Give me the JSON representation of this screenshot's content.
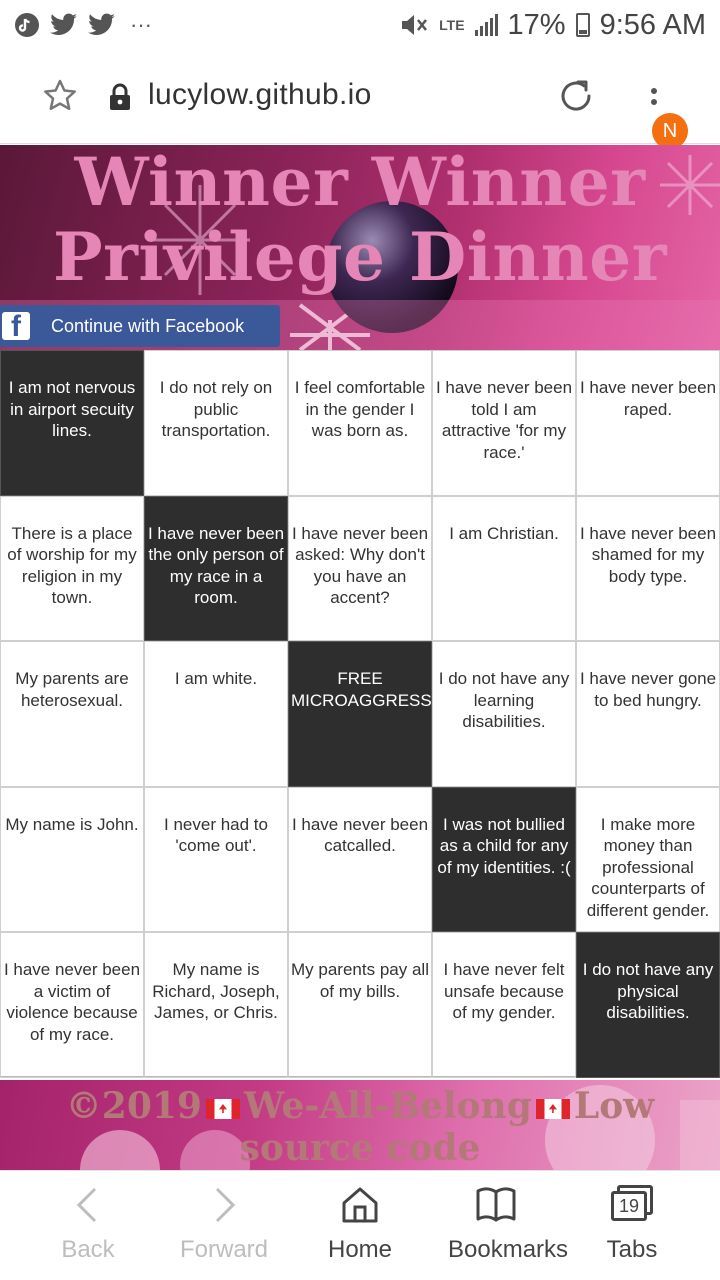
{
  "status_bar": {
    "battery": "17%",
    "time": "9:56 AM",
    "network": "LTE",
    "notifications": "···"
  },
  "browser": {
    "url": "lucylow.github.io",
    "profile_initial": "N"
  },
  "banner": {
    "title_line1": "Winner Winner",
    "title_line2": "Privilege Dinner",
    "facebook_button": "Continue with Facebook"
  },
  "bingo": {
    "cells": [
      {
        "text": "I am not nervous in airport secuity lines.",
        "dark": true
      },
      {
        "text": "I do not rely on public transportation.",
        "dark": false
      },
      {
        "text": "I feel comfortable in the gender I was born as.",
        "dark": false
      },
      {
        "text": "I have never been told I am attractive 'for my race.'",
        "dark": false
      },
      {
        "text": "I have never been raped.",
        "dark": false
      },
      {
        "text": "There is a place of worship for my religion in my town.",
        "dark": false
      },
      {
        "text": "I have never been the only person of my race in a room.",
        "dark": true
      },
      {
        "text": "I have never been asked: Why don't you have an accent?",
        "dark": false
      },
      {
        "text": "I am Christian.",
        "dark": false
      },
      {
        "text": "I have never been shamed for my body type.",
        "dark": false
      },
      {
        "text": "My parents are heterosexual.",
        "dark": false
      },
      {
        "text": "I am white.",
        "dark": false
      },
      {
        "text": "FREE MICROAGGRESSI",
        "dark": true
      },
      {
        "text": "I do not have any learning disabilities.",
        "dark": false
      },
      {
        "text": "I have never gone to bed hungry.",
        "dark": false
      },
      {
        "text": "My name is John.",
        "dark": false
      },
      {
        "text": "I never had to 'come out'.",
        "dark": false
      },
      {
        "text": "I have never been catcalled.",
        "dark": false
      },
      {
        "text": "I was not bullied as a child for any of my identities. :(",
        "dark": true
      },
      {
        "text": "I make more money than professional counterparts of different gender.",
        "dark": false
      },
      {
        "text": "I have never been a victim of violence because of my race.",
        "dark": false
      },
      {
        "text": "My name is Richard, Joseph, James, or Chris.",
        "dark": false
      },
      {
        "text": "My parents pay all of my bills.",
        "dark": false
      },
      {
        "text": "I have never felt unsafe because of my gender.",
        "dark": false
      },
      {
        "text": "I do not have any physical disabilities.",
        "dark": true
      }
    ]
  },
  "footer": {
    "copyright": "©2019",
    "name": "We-All-Belong",
    "suffix": "Low",
    "line2": "source code"
  },
  "bottom_nav": {
    "back": "Back",
    "forward": "Forward",
    "home": "Home",
    "bookmarks": "Bookmarks",
    "tabs": "Tabs",
    "tab_count": "19"
  }
}
